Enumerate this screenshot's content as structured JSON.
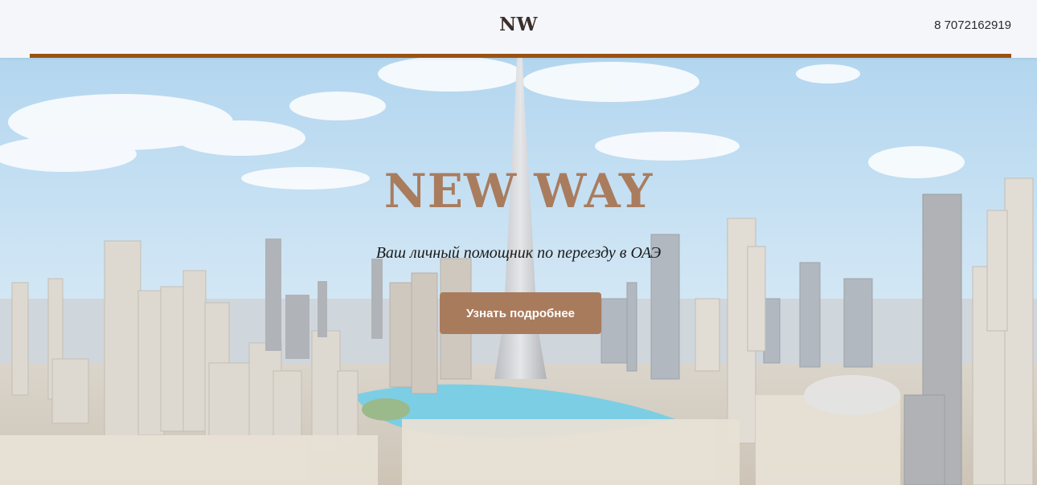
{
  "header": {
    "logo": "NW",
    "phone": "8 7072162919"
  },
  "hero": {
    "title": "NEW WAY",
    "subtitle": "Ваш личный помощник по переезду в ОАЭ",
    "cta_label": "Узнать подробнее"
  },
  "colors": {
    "accent": "#9a5213",
    "title": "#a97c5e",
    "button": "#a97b5d",
    "header_bg": "#f5f6fa"
  }
}
